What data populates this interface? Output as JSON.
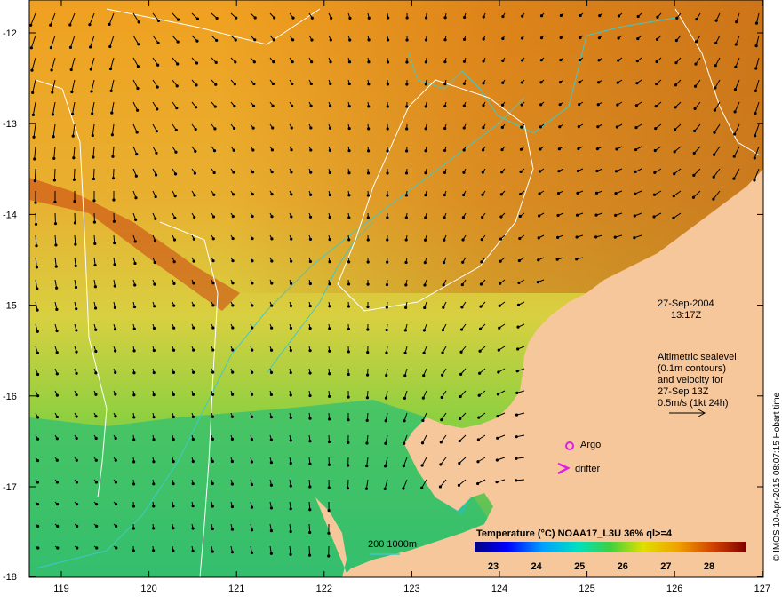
{
  "map": {
    "lat_ticks": [
      "-12",
      "-13",
      "-14",
      "-15",
      "-16",
      "-17",
      "-18"
    ],
    "lon_ticks": [
      "119",
      "120",
      "121",
      "122",
      "123",
      "124",
      "125",
      "126",
      "127"
    ],
    "date": "27-Sep-2004",
    "time": "13:17Z",
    "altimetry_lines": [
      "Altimetric sealevel",
      "(0.1m contours)",
      "and velocity for",
      "27-Sep 13Z",
      "0.5m/s (1kt 24h)"
    ],
    "argo_label": "Argo",
    "drifter_label": "drifter",
    "depth_label": "200  1000m",
    "colorbar_title": "Temperature (°C) NOAA17_L3U 36% ql>=4",
    "colorbar_ticks": [
      "23",
      "24",
      "25",
      "26",
      "27",
      "28"
    ],
    "credit": "© IMOS 10-Apr-2015 08:07:15 Hobart time",
    "colors": {
      "land": "#f7c79c",
      "isobath": "#40c8c8",
      "contour": "#ffffff",
      "argo_marker": "#e020e0",
      "drifter_marker": "#e020e0"
    }
  }
}
